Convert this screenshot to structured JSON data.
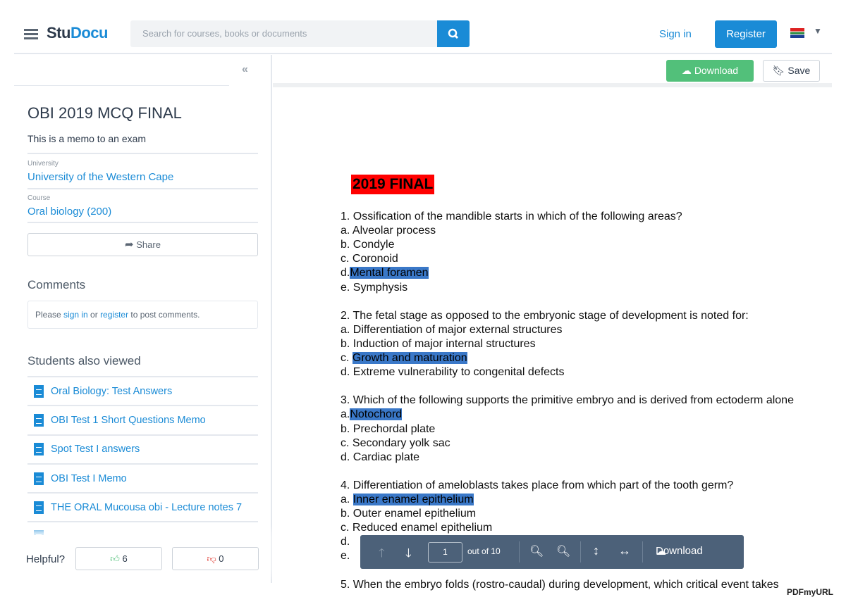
{
  "header": {
    "logo_a": "Stu",
    "logo_b": "Docu",
    "search_placeholder": "Search for courses, books or documents",
    "sign_in": "Sign in",
    "register": "Register"
  },
  "toolbar": {
    "download": "Download",
    "save": "Save"
  },
  "sidebar": {
    "title": "OBI 2019 MCQ FINAL",
    "description": "This is a memo to an exam",
    "university_label": "University",
    "university": "University of the Western Cape",
    "course_label": "Course",
    "course": "Oral biology (200)",
    "share": "Share",
    "comments_heading": "Comments",
    "comment_please": "Please ",
    "comment_signin": "sign in",
    "comment_or": " or ",
    "comment_register": "register",
    "comment_tail": " to post comments.",
    "also_viewed_heading": "Students also viewed",
    "also_viewed": [
      "Oral Biology: Test Answers",
      "OBI Test 1 Short Questions Memo",
      "Spot Test I answers",
      "OBI Test I Memo",
      "THE ORAL Mucousa obi - Lecture notes 7"
    ],
    "helpful_label": "Helpful?",
    "upvotes": "6",
    "downvotes": "0"
  },
  "document": {
    "heading": "2019 FINAL",
    "lines": [
      {
        "t": "1. Ossification of the mandible starts in which of the following areas?"
      },
      {
        "t": "a. Alveolar process"
      },
      {
        "t": "b. Condyle"
      },
      {
        "t": "c. Coronoid"
      },
      {
        "p": "d.",
        "h": "Mental foramen"
      },
      {
        "t": "e. Symphysis"
      },
      {
        "t": ""
      },
      {
        "t": "2. The fetal stage as opposed to the embryonic stage of development is noted for:"
      },
      {
        "t": "a. Differentiation of major external structures"
      },
      {
        "t": "b. Induction of major internal structures"
      },
      {
        "p": "c. ",
        "h": "Growth and maturation"
      },
      {
        "t": "d. Extreme vulnerability to congenital defects"
      },
      {
        "t": ""
      },
      {
        "t": "3. Which of the following supports the primitive embryo and is derived from ectoderm alone"
      },
      {
        "p": "a.",
        "h": "Notochord"
      },
      {
        "t": "b. Prechordal plate"
      },
      {
        "t": "c. Secondary yolk sac"
      },
      {
        "t": "d. Cardiac plate"
      },
      {
        "t": ""
      },
      {
        "t": "4. Differentiation of ameloblasts takes place from which part of the tooth germ?"
      },
      {
        "p": "a. ",
        "h": "Inner enamel epithelium"
      },
      {
        "t": "b. Outer enamel epithelium"
      },
      {
        "t": "c. Reduced enamel epithelium"
      },
      {
        "t": "d."
      },
      {
        "t": "e."
      },
      {
        "t": ""
      },
      {
        "t": "5. When the embryo folds (rostro-caudal) during development, which critical event takes"
      }
    ]
  },
  "viewer": {
    "page": "1",
    "out_of": "out of 10",
    "download": "Download"
  },
  "watermark": "PDFmyURL",
  "colors": {
    "accent": "#1a8bd6",
    "download_green": "#52c07a",
    "highlight": "#3a78c8",
    "viewer_bar": "#4c6179"
  }
}
